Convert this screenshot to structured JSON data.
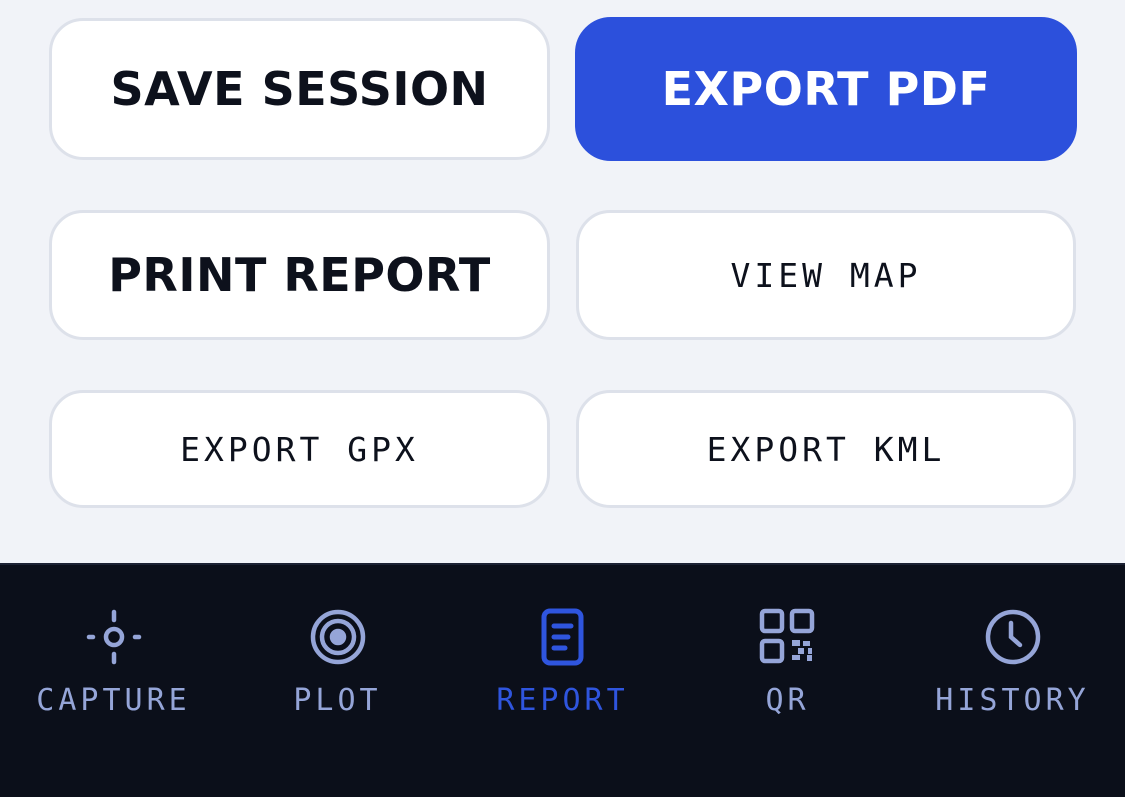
{
  "actions": {
    "save_session": "SAVE SESSION",
    "export_pdf": "EXPORT PDF",
    "print_report": "PRINT REPORT",
    "view_map": "VIEW MAP",
    "export_gpx": "EXPORT GPX",
    "export_kml": "EXPORT KML"
  },
  "tabbar": {
    "active": "REPORT",
    "tabs": [
      {
        "label": "CAPTURE",
        "icon": "crosshair-icon"
      },
      {
        "label": "PLOT",
        "icon": "target-icon"
      },
      {
        "label": "REPORT",
        "icon": "document-icon"
      },
      {
        "label": "QR",
        "icon": "qr-code-icon"
      },
      {
        "label": "HISTORY",
        "icon": "clock-icon"
      }
    ]
  },
  "colors": {
    "primary": "#2c50dc",
    "background": "#f1f3f8",
    "tabbar_background": "#0b0f1a",
    "tab_inactive": "#95a5d8",
    "tab_active": "#2f55de"
  }
}
